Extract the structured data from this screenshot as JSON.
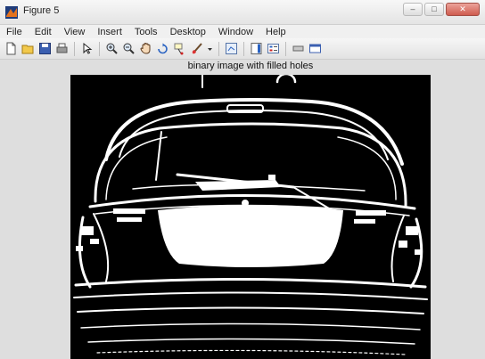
{
  "window": {
    "title": "Figure 5"
  },
  "menu": [
    "File",
    "Edit",
    "View",
    "Insert",
    "Tools",
    "Desktop",
    "Window",
    "Help"
  ],
  "toolbar": {
    "icons": [
      "new-file-icon",
      "open-folder-icon",
      "save-icon",
      "print-icon",
      "pointer-icon",
      "zoom-in-icon",
      "zoom-out-icon",
      "pan-icon",
      "rotate-3d-icon",
      "data-cursor-icon",
      "brush-icon",
      "dropdown-arrow-icon",
      "link-plot-icon",
      "colorbar-icon",
      "legend-icon",
      "hide-plot-tools-icon",
      "show-plot-tools-icon"
    ]
  },
  "figure": {
    "title": "binary image with filled holes"
  },
  "colors": {
    "plot_background": "#000000",
    "foreground": "#ffffff",
    "close_button": "#cf5c4f"
  }
}
